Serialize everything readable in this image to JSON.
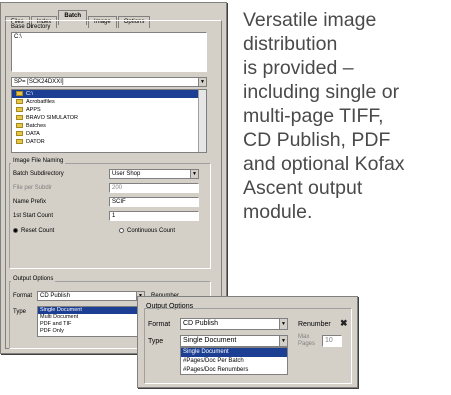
{
  "dialog": {
    "tabs": [
      "Files",
      "Index",
      "Batch",
      "Image",
      "Options"
    ],
    "active_tab": "Batch",
    "base_directory_label": "Base Directory",
    "base_directory_value": "C:\\",
    "drive_value": "SP= [SCK24DXXI]",
    "tree_items": [
      {
        "label": "C:\\",
        "selected": true
      },
      {
        "label": "Acrobatfiles",
        "selected": false
      },
      {
        "label": "APPS",
        "selected": false
      },
      {
        "label": "BRAVO SIMULATOR",
        "selected": false
      },
      {
        "label": "Batches",
        "selected": false
      },
      {
        "label": "DATA",
        "selected": false
      },
      {
        "label": "DATOR",
        "selected": false
      }
    ],
    "image_file_naming_label": "Image File Naming",
    "batch_subdirectory_label": "Batch Subdirectory",
    "batch_subdirectory_value": "User Shop",
    "file_per_subdir_label": "File per Subdir",
    "file_per_subdir_value": "200",
    "name_prefix_label": "Name Prefix",
    "name_prefix_value": "SCIF",
    "start_count_label": "1st Start Count",
    "start_count_value": "1",
    "radio_reset": "Reset Count",
    "radio_continuous": "Continuous Count",
    "output_options_label": "Output Options",
    "format_label": "Format",
    "format_value": "CD Publish",
    "renumber_label": "Renumber",
    "type_label": "Type",
    "type_options": [
      "Single Document",
      "Multi Document",
      "PDF and TIF",
      "PDF Only"
    ]
  },
  "caption": {
    "lines": [
      "Versatile image",
      "distribution",
      "is provided –",
      "including single or",
      "multi-page TIFF,",
      "CD Publish, PDF",
      "and optional Kofax",
      "Ascent output",
      "module."
    ]
  },
  "inset": {
    "output_options_label": "Output Options",
    "format_label": "Format",
    "format_value": "CD Publish",
    "renumber_label": "Renumber",
    "renumber_mark": "✖",
    "type_label": "Type",
    "type_value": "Single Document",
    "max_pages_label": "Max Pages",
    "max_pages_value": "10",
    "type_options": [
      "Single Document",
      "#Pages/Doc Per Batch",
      "#Pages/Doc Renumbers"
    ]
  }
}
